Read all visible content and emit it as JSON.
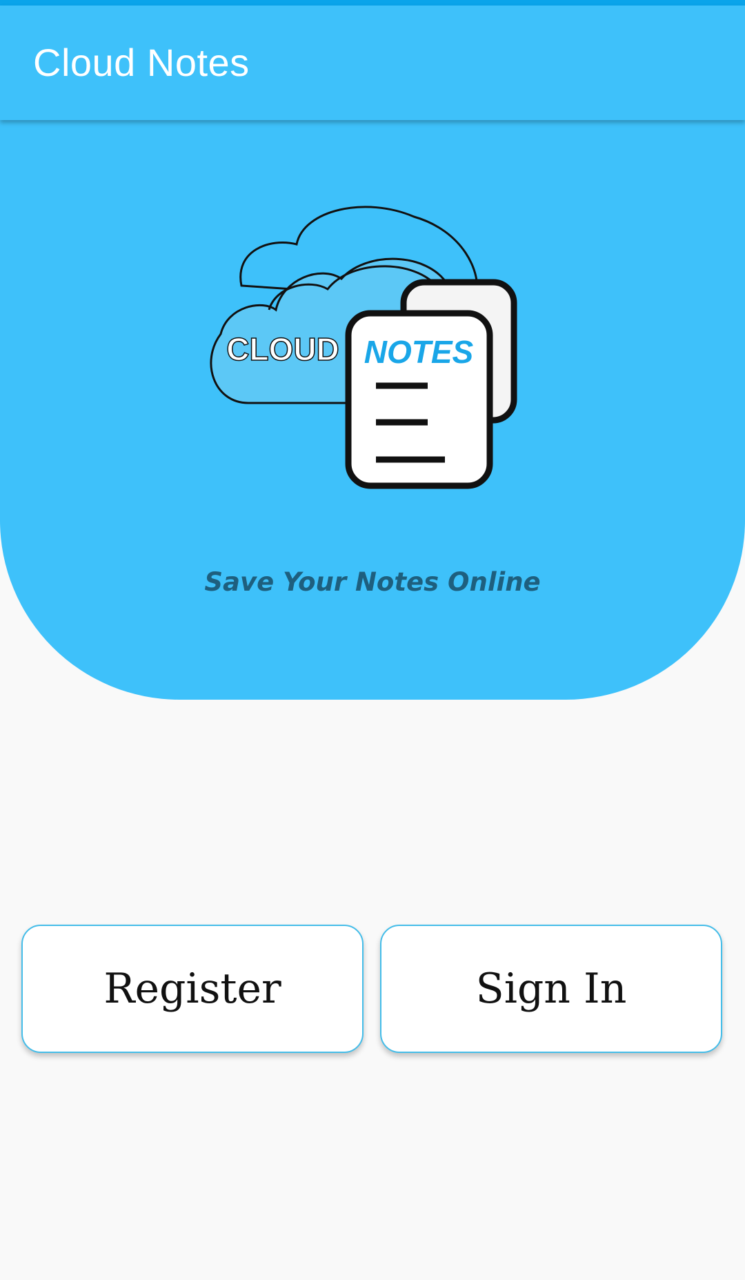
{
  "app_bar": {
    "title": "Cloud Notes"
  },
  "hero": {
    "logo": {
      "word_cloud": "CLOUD",
      "word_notes": "NOTES",
      "icon": "cloud-notes-logo"
    },
    "tagline": "Save Your Notes Online"
  },
  "actions": {
    "register_label": "Register",
    "signin_label": "Sign In"
  },
  "colors": {
    "primary": "#3ec1fa",
    "status_bar": "#0aa4ea",
    "tagline": "#1e5f7e",
    "notes_text": "#19a6e8",
    "background": "#f9f9f9"
  }
}
